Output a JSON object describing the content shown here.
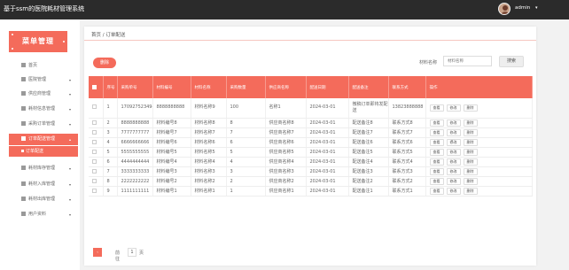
{
  "app": {
    "title": "基于ssm的医院耗材管理系统",
    "user": "admin",
    "user_caret": "▾"
  },
  "sidebar": {
    "menu_title": "菜单管理",
    "items": [
      {
        "label": "首页",
        "caret": ""
      },
      {
        "label": "医院管理",
        "caret": "▾"
      },
      {
        "label": "供应商管理",
        "caret": "▾"
      },
      {
        "label": "耗材信息管理",
        "caret": "▾"
      },
      {
        "label": "采购订单管理",
        "caret": "▾"
      },
      {
        "label": "订单配送管理",
        "caret": "▴"
      },
      {
        "label": "订单配送",
        "caret": ""
      },
      {
        "label": "耗材库存管理",
        "caret": "▾"
      },
      {
        "label": "耗材入库管理",
        "caret": "▾"
      },
      {
        "label": "耗材出库管理",
        "caret": "▾"
      },
      {
        "label": "用户资料",
        "caret": "▾"
      }
    ]
  },
  "breadcrumb": "首页 / 订单配送",
  "toolbar": {
    "delete_label": "删除",
    "search_label": "材料名称",
    "search_placeholder": "材料名称",
    "search_button": "搜索"
  },
  "table": {
    "headers": [
      "",
      "序号",
      "采购单号",
      "材料编号",
      "材料名称",
      "采购数量",
      "供应商名称",
      "配送日期",
      "配送备注",
      "联系方式",
      "操作"
    ],
    "actions": [
      "查看",
      "修改",
      "删除"
    ],
    "rows": [
      {
        "index": "1",
        "order_no": "1709275234949",
        "material_no": "8888888888",
        "material_name": "材料名称9",
        "qty": "100",
        "supplier": "名称1",
        "date": "2024-03-01",
        "note": "微稿订单即将发配送",
        "contact": "13823888888"
      },
      {
        "index": "2",
        "order_no": "8888888888",
        "material_no": "材料编号8",
        "material_name": "材料名称8",
        "qty": "8",
        "supplier": "供应商名称8",
        "date": "2024-03-01",
        "note": "配送备注8",
        "contact": "联系方式8"
      },
      {
        "index": "3",
        "order_no": "7777777777",
        "material_no": "材料编号7",
        "material_name": "材料名称7",
        "qty": "7",
        "supplier": "供应商名称7",
        "date": "2024-03-01",
        "note": "配送备注7",
        "contact": "联系方式7"
      },
      {
        "index": "4",
        "order_no": "6666666666",
        "material_no": "材料编号6",
        "material_name": "材料名称6",
        "qty": "6",
        "supplier": "供应商名称6",
        "date": "2024-03-01",
        "note": "配送备注6",
        "contact": "联系方式6"
      },
      {
        "index": "5",
        "order_no": "5555555555",
        "material_no": "材料编号5",
        "material_name": "材料名称5",
        "qty": "5",
        "supplier": "供应商名称5",
        "date": "2024-03-01",
        "note": "配送备注5",
        "contact": "联系方式5"
      },
      {
        "index": "6",
        "order_no": "4444444444",
        "material_no": "材料编号4",
        "material_name": "材料名称4",
        "qty": "4",
        "supplier": "供应商名称4",
        "date": "2024-03-01",
        "note": "配送备注4",
        "contact": "联系方式4"
      },
      {
        "index": "7",
        "order_no": "3333333333",
        "material_no": "材料编号3",
        "material_name": "材料名称3",
        "qty": "3",
        "supplier": "供应商名称3",
        "date": "2024-03-01",
        "note": "配送备注3",
        "contact": "联系方式3"
      },
      {
        "index": "8",
        "order_no": "2222222222",
        "material_no": "材料编号2",
        "material_name": "材料名称2",
        "qty": "2",
        "supplier": "供应商名称2",
        "date": "2024-03-01",
        "note": "配送备注2",
        "contact": "联系方式2"
      },
      {
        "index": "9",
        "order_no": "1111111111",
        "material_no": "材料编号1",
        "material_name": "材料名称1",
        "qty": "1",
        "supplier": "供应商名称1",
        "date": "2024-03-01",
        "note": "配送备注1",
        "contact": "联系方式1"
      }
    ]
  },
  "pager": {
    "prev": "‹",
    "label": "前往",
    "page": "1",
    "suffix": "页"
  },
  "colors": {
    "accent": "#f46b5b",
    "topbar": "#2b2b2b"
  }
}
